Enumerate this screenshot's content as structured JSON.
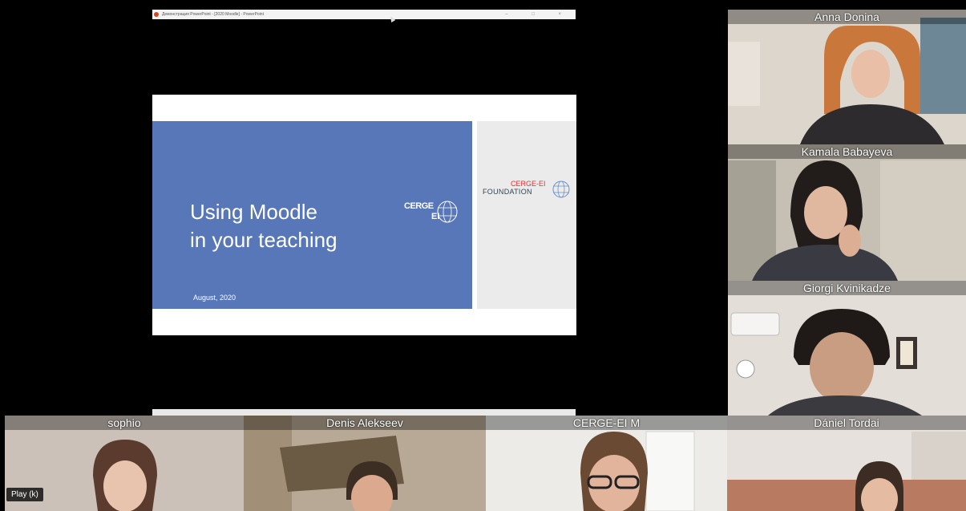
{
  "powerpoint": {
    "window_title": "Демонстрация PowerPoint - [2020 Moodle] - PowerPoint",
    "window_controls": "–  □  ×"
  },
  "slide": {
    "title_line1": "Using Moodle",
    "title_line2": "in your teaching",
    "date": "August, 2020",
    "logo_cerge_line1": "CERGE",
    "logo_cerge_line2": "EI",
    "logo_foundation_line1": "CERGE-EI",
    "logo_foundation_line2": "FOUNDATION",
    "colors": {
      "blue_panel": "#5877b8",
      "gray_panel": "#ebebeb",
      "foundation_red": "#dd3333"
    }
  },
  "participants": [
    {
      "name": "Anna Donina"
    },
    {
      "name": "Kamala Babayeva"
    },
    {
      "name": "Giorgi Kvinikadze"
    },
    {
      "name": "sophio"
    },
    {
      "name": "Denis Alekseev"
    },
    {
      "name": "CERGE-EI M"
    },
    {
      "name": "Dániel Tordai"
    }
  ],
  "player": {
    "tooltip": "Play (k)"
  }
}
